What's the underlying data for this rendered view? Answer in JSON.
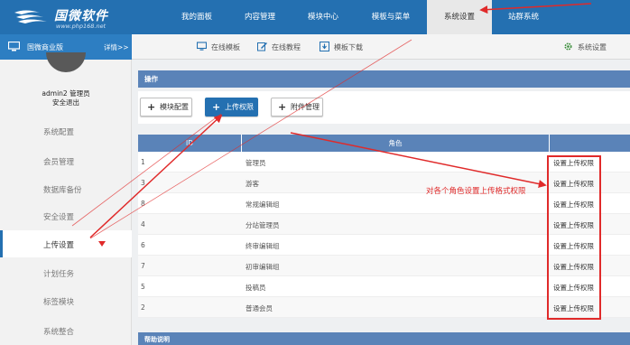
{
  "header": {
    "logo_name": "国微软件",
    "logo_url": "www.php168.net",
    "nav": [
      {
        "label": "我的面板"
      },
      {
        "label": "内容管理"
      },
      {
        "label": "模块中心"
      },
      {
        "label": "模板与菜单"
      },
      {
        "label": "系统设置"
      },
      {
        "label": "站群系统"
      }
    ],
    "accent": "#2470b1"
  },
  "subbar": {
    "edition": "国微商业版",
    "details": "详情>>",
    "links": [
      {
        "label": "在线模板",
        "icon": "monitor-icon"
      },
      {
        "label": "在线教程",
        "icon": "edit-icon"
      },
      {
        "label": "模板下载",
        "icon": "download-icon"
      }
    ],
    "settings": "系统设置",
    "settings_icon": "gear-icon"
  },
  "sidebar": {
    "user_line": "admin2 管理员",
    "logout": "安全退出",
    "items": [
      {
        "label": "系统配置"
      },
      {
        "label": "会员管理"
      },
      {
        "label": "数据库备份"
      },
      {
        "label": "安全设置"
      },
      {
        "label": "上传设置"
      },
      {
        "label": "计划任务"
      },
      {
        "label": "标签模块"
      },
      {
        "label": "系统整合"
      }
    ]
  },
  "main": {
    "panel_title": "操作",
    "buttons": [
      {
        "label": "模块配置"
      },
      {
        "label": "上传权限"
      },
      {
        "label": "附件管理"
      }
    ],
    "table": {
      "columns": [
        "ID",
        "角色",
        ""
      ],
      "rows": [
        {
          "id": "1",
          "role": "管理员",
          "action": "设置上传权限"
        },
        {
          "id": "3",
          "role": "游客",
          "action": "设置上传权限"
        },
        {
          "id": "8",
          "role": "常规编辑组",
          "action": "设置上传权限"
        },
        {
          "id": "4",
          "role": "分站管理员",
          "action": "设置上传权限"
        },
        {
          "id": "6",
          "role": "终审编辑组",
          "action": "设置上传权限"
        },
        {
          "id": "7",
          "role": "初审编辑组",
          "action": "设置上传权限"
        },
        {
          "id": "5",
          "role": "投稿员",
          "action": "设置上传权限"
        },
        {
          "id": "2",
          "role": "普通会员",
          "action": "设置上传权限"
        }
      ]
    },
    "help_title": "帮助说明"
  },
  "annotation": {
    "text": "对各个角色设置上传格式权限",
    "color": "#e02a2a"
  }
}
